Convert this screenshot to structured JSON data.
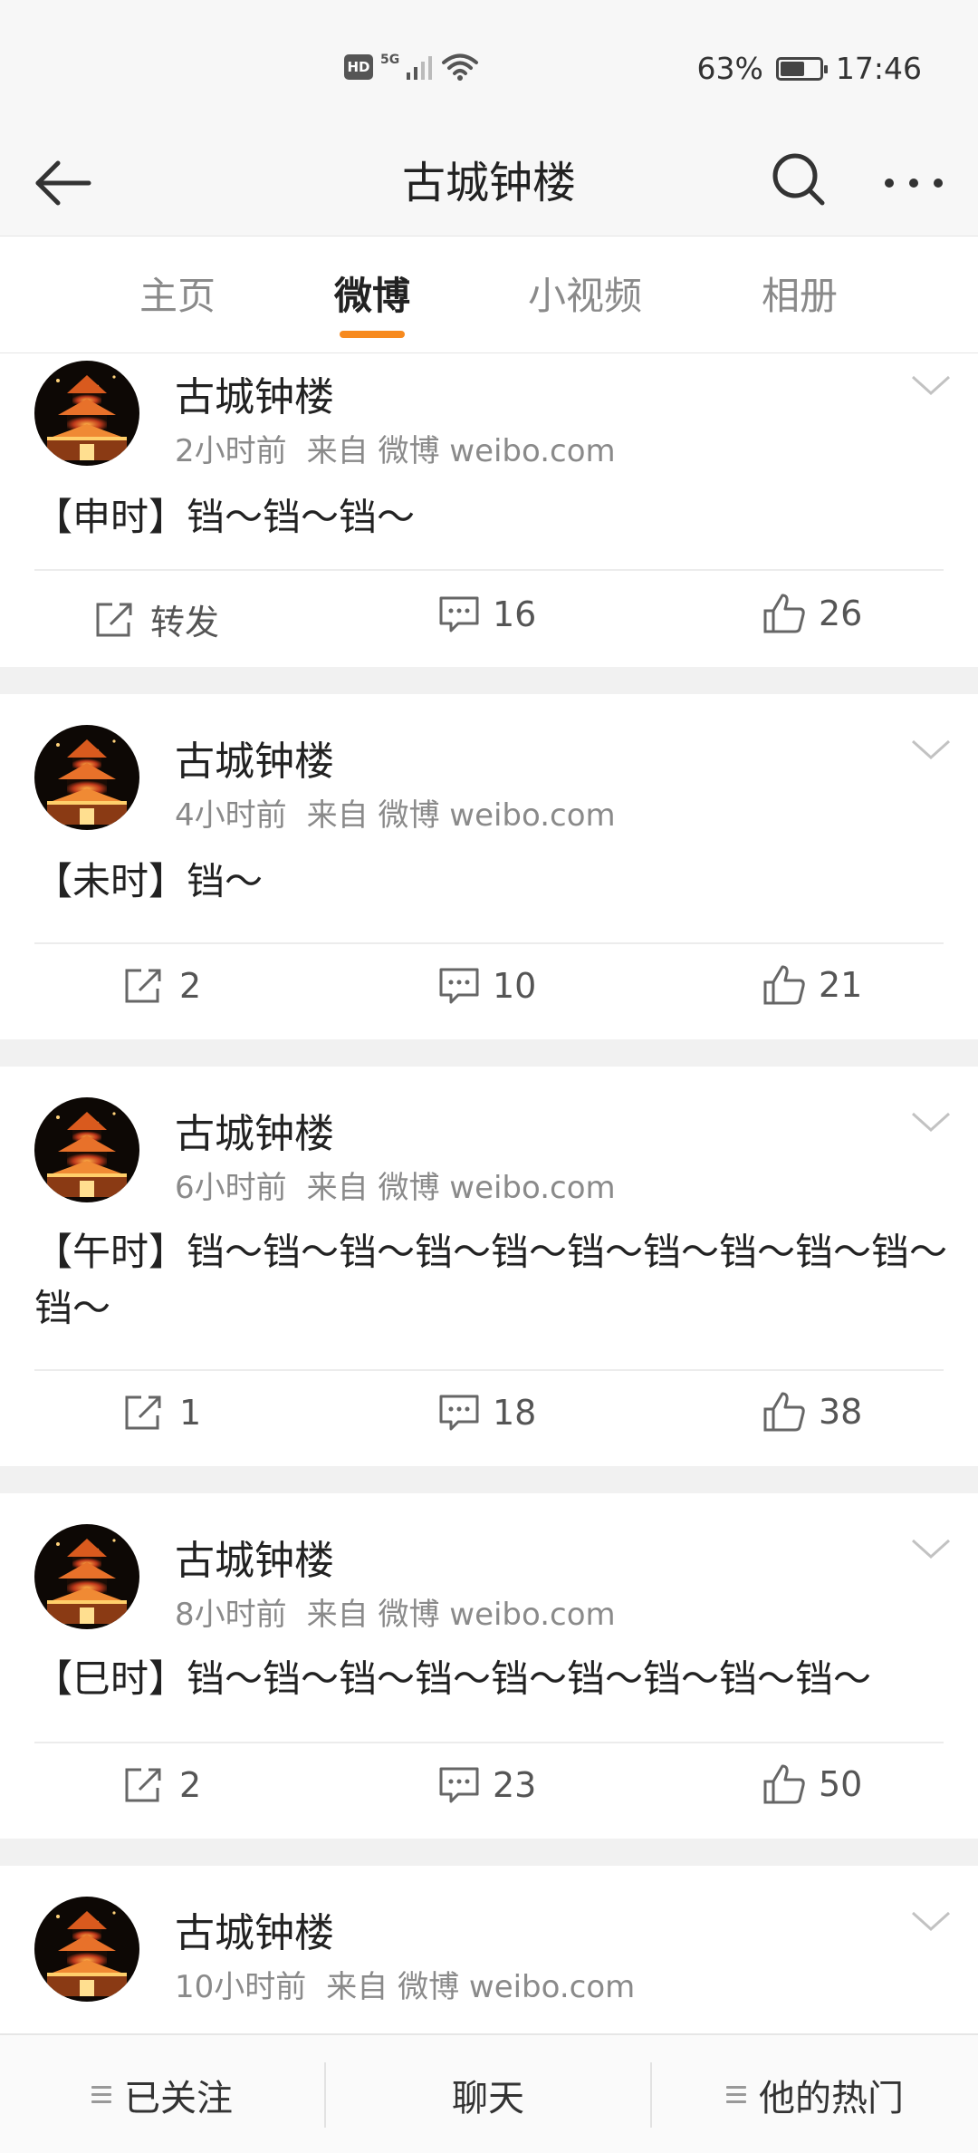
{
  "status_bar": {
    "network_badge": "HD",
    "network_type": "5G",
    "battery_percent": "63%",
    "battery_level": 0.63,
    "time": "17:46"
  },
  "nav": {
    "title": "古城钟楼",
    "icons": [
      "back-arrow-icon",
      "search-icon",
      "more-icon"
    ]
  },
  "tabs": [
    {
      "label": "主页",
      "active": false
    },
    {
      "label": "微博",
      "active": true
    },
    {
      "label": "小视频",
      "active": false
    },
    {
      "label": "相册",
      "active": false
    }
  ],
  "accent_color": "#f78a1e",
  "posts": [
    {
      "author": "古城钟楼",
      "time": "2小时前",
      "source": "来自 微博 weibo.com",
      "text": "【申时】铛～铛～铛～",
      "repost": "转发",
      "comments": "16",
      "likes": "26"
    },
    {
      "author": "古城钟楼",
      "time": "4小时前",
      "source": "来自 微博 weibo.com",
      "text": "【未时】铛～",
      "repost": "2",
      "comments": "10",
      "likes": "21"
    },
    {
      "author": "古城钟楼",
      "time": "6小时前",
      "source": "来自 微博 weibo.com",
      "text": "【午时】铛～铛～铛～铛～铛～铛～铛～铛～铛～铛～铛～",
      "repost": "1",
      "comments": "18",
      "likes": "38"
    },
    {
      "author": "古城钟楼",
      "time": "8小时前",
      "source": "来自 微博 weibo.com",
      "text": "【巳时】铛～铛～铛～铛～铛～铛～铛～铛～铛～",
      "repost": "2",
      "comments": "23",
      "likes": "50"
    },
    {
      "author": "古城钟楼",
      "time": "10小时前",
      "source": "来自 微博 weibo.com"
    }
  ],
  "bottom_bar": {
    "following": "已关注",
    "chat": "聊天",
    "hot": "他的热门"
  }
}
